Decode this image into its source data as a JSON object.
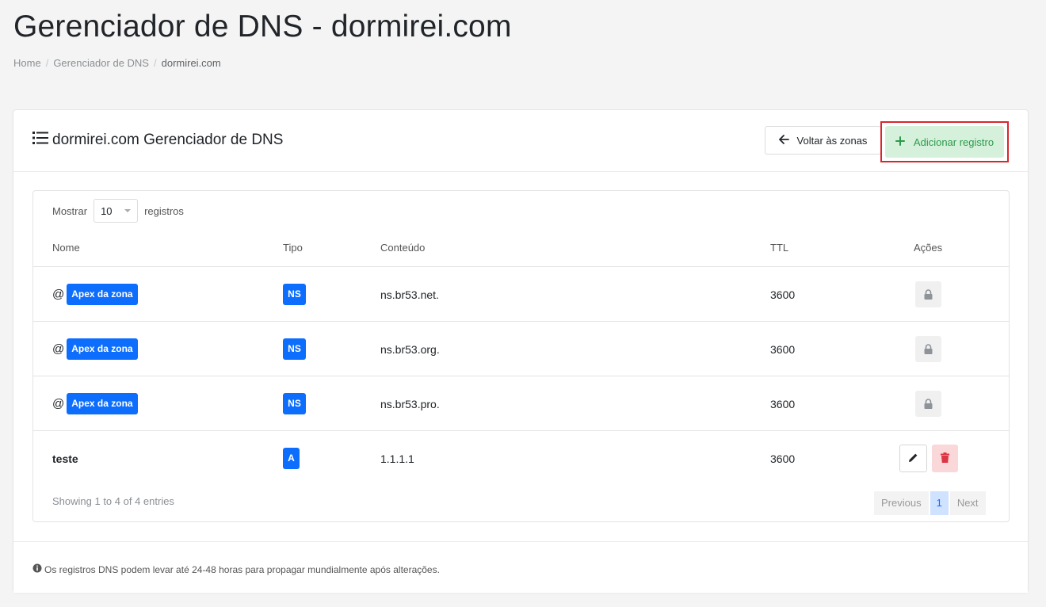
{
  "page": {
    "title": "Gerenciador de DNS - dormirei.com"
  },
  "breadcrumb": [
    {
      "label": "Home"
    },
    {
      "label": "Gerenciador de DNS"
    },
    {
      "label": "dormirei.com"
    }
  ],
  "card": {
    "title": "dormirei.com Gerenciador de DNS",
    "back_label": "Voltar às zonas",
    "add_label": "Adicionar registro"
  },
  "table": {
    "show_label": "Mostrar",
    "page_size": "10",
    "records_label": "registros",
    "columns": [
      "Nome",
      "Tipo",
      "Conteúdo",
      "TTL",
      "Ações"
    ],
    "rows": [
      {
        "name_prefix": "@",
        "name_badge": "Apex da zona",
        "type": "NS",
        "content": "ns.br53.net.",
        "ttl": "3600",
        "locked": true
      },
      {
        "name_prefix": "@",
        "name_badge": "Apex da zona",
        "type": "NS",
        "content": "ns.br53.org.",
        "ttl": "3600",
        "locked": true
      },
      {
        "name_prefix": "@",
        "name_badge": "Apex da zona",
        "type": "NS",
        "content": "ns.br53.pro.",
        "ttl": "3600",
        "locked": true
      },
      {
        "name": "teste",
        "type": "A",
        "content": "1.1.1.1",
        "ttl": "3600",
        "locked": false
      }
    ],
    "info": "Showing 1 to 4 of 4 entries",
    "pagination": {
      "previous": "Previous",
      "current": "1",
      "next": "Next"
    }
  },
  "footer": {
    "note": "Os registros DNS podem levar até 24-48 horas para propagar mundialmente após alterações."
  },
  "colors": {
    "primary": "#0d6efd",
    "success_text": "#2d9a4a",
    "success_bg": "#d5f1dc",
    "danger": "#dc3545",
    "highlight_border": "#d9262c"
  },
  "icons": {
    "title": "list-icon",
    "back": "arrow-left-icon",
    "add": "plus-icon",
    "locked": "lock-icon",
    "edit": "pencil-icon",
    "delete": "trash-icon",
    "info": "info-circle-icon"
  }
}
